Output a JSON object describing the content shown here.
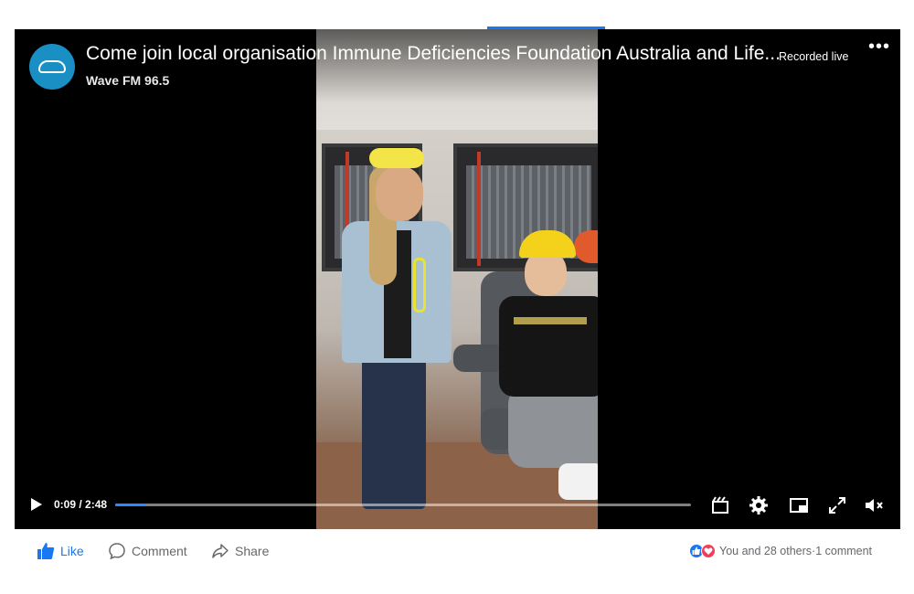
{
  "post": {
    "title": "Come join local organisation Immune Deficiencies Foundation Australia and Life...",
    "page_name": "Wave FM 96.5",
    "status": "Recorded live",
    "more_label": "•••"
  },
  "player": {
    "time_label": "0:09 / 2:48",
    "progress": 0.054,
    "icons": [
      "play-icon",
      "clip-icon",
      "settings-icon",
      "miniplayer-icon",
      "fullscreen-icon",
      "volume-muted-icon"
    ]
  },
  "actions": {
    "like_label": "Like",
    "comment_label": "Comment",
    "share_label": "Share"
  },
  "reactions": {
    "summary": "You and 28 others",
    "separator": " · ",
    "comments": "1 comment"
  },
  "colors": {
    "accent": "#1877f2",
    "love": "#f33e58",
    "player_bg": "#000000",
    "avatar": "#1a8fc4"
  }
}
